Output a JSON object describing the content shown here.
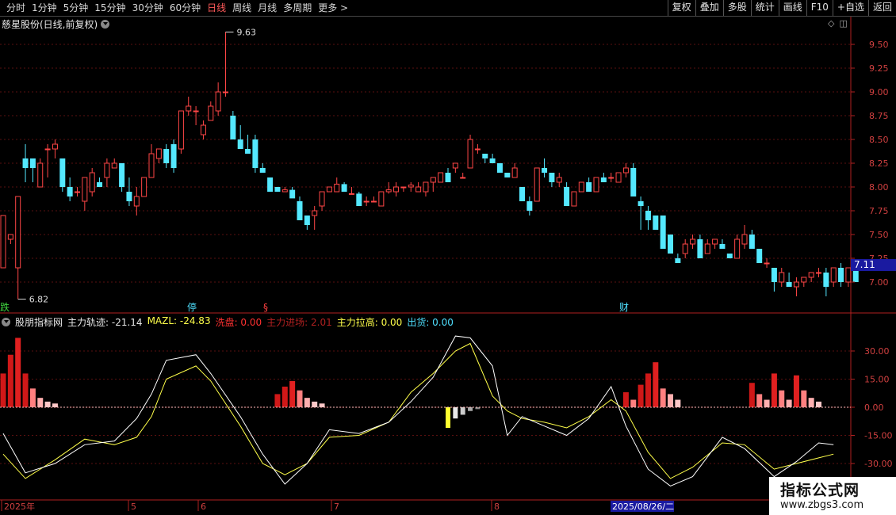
{
  "toolbar": {
    "period_tabs": [
      "分时",
      "1分钟",
      "5分钟",
      "15分钟",
      "30分钟",
      "60分钟",
      "日线",
      "周线",
      "月线",
      "多周期",
      "更多 >"
    ],
    "active_tab": "日线",
    "right_tools": [
      "复权",
      "叠加",
      "多股",
      "统计",
      "画线",
      "F10",
      "+自选",
      "返回"
    ]
  },
  "stock": {
    "title": "慈星股份(日线,前复权)"
  },
  "price_axis": {
    "ticks": [
      "9.50",
      "9.25",
      "9.00",
      "8.75",
      "8.50",
      "8.25",
      "8.00",
      "7.75",
      "7.50",
      "7.25",
      "7.00"
    ],
    "current": "7.11"
  },
  "annotations": {
    "high": "9.63",
    "low": "6.82",
    "markers": [
      {
        "text": "跌",
        "color": "#3fd43f"
      },
      {
        "text": "停",
        "color": "#4fe0ff"
      },
      {
        "text": "§",
        "color": "#ff4040"
      },
      {
        "text": "财",
        "color": "#4fe0ff"
      }
    ]
  },
  "indicator": {
    "name": "股朋指标网",
    "items": [
      {
        "label": "主力轨迹: -21.14",
        "color": "#e8e8e8"
      },
      {
        "label": "MAZL: -24.83",
        "color": "#ffff4a"
      },
      {
        "label": "洗盘: 0.00",
        "color": "#ff3030"
      },
      {
        "label": "主力进场: 2.01",
        "color": "#b02020"
      },
      {
        "label": "主力拉高: 0.00",
        "color": "#ffff4a"
      },
      {
        "label": "出货: 0.00",
        "color": "#4fe0ff"
      }
    ],
    "ticks": [
      "30.00",
      "15.00",
      "0.00",
      "-15.00",
      "-30.00"
    ]
  },
  "date_axis": {
    "labels": [
      "2025年",
      "5",
      "6",
      "7",
      "8"
    ],
    "cursor": "2025/08/26/二"
  },
  "watermark": {
    "title": "指标公式网",
    "url": "www.zbgs3.com"
  },
  "chart_data": {
    "type": "candlestick",
    "price_range": [
      6.8,
      9.7
    ],
    "candles": [
      [
        7.15,
        7.7,
        7.15,
        7.7
      ],
      [
        7.45,
        7.5,
        7.4,
        7.5
      ],
      [
        7.15,
        7.9,
        6.82,
        7.9
      ],
      [
        8.3,
        8.45,
        8.05,
        8.2
      ],
      [
        8.3,
        8.3,
        8.05,
        8.2
      ],
      [
        8.0,
        8.3,
        8.0,
        8.25
      ],
      [
        8.4,
        8.45,
        8.1,
        8.4
      ],
      [
        8.4,
        8.5,
        8.3,
        8.45
      ],
      [
        8.3,
        8.3,
        7.95,
        8.0
      ],
      [
        8.0,
        8.1,
        7.85,
        7.9
      ],
      [
        7.95,
        8.0,
        7.9,
        7.95
      ],
      [
        7.85,
        8.1,
        7.75,
        8.1
      ],
      [
        7.95,
        8.2,
        7.9,
        8.15
      ],
      [
        8.05,
        8.1,
        8.0,
        8.0
      ],
      [
        8.1,
        8.3,
        8.0,
        8.25
      ],
      [
        8.2,
        8.3,
        8.2,
        8.25
      ],
      [
        8.25,
        8.25,
        7.95,
        8.0
      ],
      [
        7.95,
        8.1,
        7.8,
        7.85
      ],
      [
        7.8,
        8.0,
        7.7,
        7.9
      ],
      [
        7.9,
        8.1,
        7.9,
        8.1
      ],
      [
        8.1,
        8.45,
        8.1,
        8.35
      ],
      [
        8.3,
        8.4,
        8.25,
        8.4
      ],
      [
        8.4,
        8.45,
        8.2,
        8.25
      ],
      [
        8.45,
        8.5,
        8.15,
        8.2
      ],
      [
        8.4,
        8.8,
        8.35,
        8.8
      ],
      [
        8.8,
        8.95,
        8.75,
        8.85
      ],
      [
        8.8,
        8.85,
        8.65,
        8.8
      ],
      [
        8.55,
        8.7,
        8.5,
        8.65
      ],
      [
        8.7,
        8.9,
        8.7,
        8.85
      ],
      [
        8.8,
        9.1,
        8.75,
        9.0
      ],
      [
        9.0,
        9.63,
        8.95,
        9.0
      ],
      [
        8.75,
        8.8,
        8.55,
        8.5
      ],
      [
        8.5,
        8.65,
        8.4,
        8.4
      ],
      [
        8.4,
        8.55,
        8.35,
        8.35
      ],
      [
        8.5,
        8.55,
        8.15,
        8.2
      ],
      [
        8.2,
        8.25,
        8.15,
        8.15
      ],
      [
        8.1,
        8.1,
        7.95,
        7.95
      ],
      [
        8.0,
        8.0,
        7.95,
        7.95
      ],
      [
        7.95,
        8.0,
        7.95,
        7.97
      ],
      [
        7.97,
        8.0,
        7.9,
        7.88
      ],
      [
        7.85,
        7.9,
        7.65,
        7.65
      ],
      [
        7.7,
        7.7,
        7.55,
        7.6
      ],
      [
        7.7,
        7.8,
        7.55,
        7.75
      ],
      [
        7.8,
        7.95,
        7.75,
        7.95
      ],
      [
        7.95,
        8.0,
        7.95,
        8.0
      ],
      [
        7.95,
        8.1,
        7.95,
        8.03
      ],
      [
        8.03,
        8.05,
        7.95,
        7.95
      ],
      [
        7.93,
        8.0,
        7.93,
        7.93
      ],
      [
        7.93,
        7.95,
        7.8,
        7.8
      ],
      [
        7.85,
        7.9,
        7.8,
        7.85
      ],
      [
        7.85,
        7.9,
        7.85,
        7.85
      ],
      [
        7.8,
        7.95,
        7.8,
        7.95
      ],
      [
        7.95,
        8.05,
        7.93,
        7.97
      ],
      [
        7.95,
        8.05,
        7.9,
        8.0
      ],
      [
        8.0,
        8.0,
        7.95,
        8.0
      ],
      [
        8.0,
        8.05,
        7.95,
        8.02
      ],
      [
        7.95,
        8.05,
        7.95,
        8.0
      ],
      [
        7.95,
        8.05,
        7.9,
        8.05
      ],
      [
        8.05,
        8.1,
        7.95,
        8.1
      ],
      [
        8.05,
        8.15,
        8.05,
        8.15
      ],
      [
        8.15,
        8.2,
        8.05,
        8.05
      ],
      [
        8.2,
        8.25,
        8.15,
        8.25
      ],
      [
        8.1,
        8.15,
        8.1,
        8.1
      ],
      [
        8.2,
        8.55,
        8.2,
        8.5
      ],
      [
        8.4,
        8.45,
        8.35,
        8.4
      ],
      [
        8.35,
        8.35,
        8.25,
        8.3
      ],
      [
        8.3,
        8.35,
        8.25,
        8.25
      ],
      [
        8.25,
        8.25,
        8.15,
        8.15
      ],
      [
        8.15,
        8.15,
        8.1,
        8.1
      ],
      [
        8.1,
        8.25,
        8.1,
        8.2
      ],
      [
        8.0,
        8.0,
        7.85,
        7.85
      ],
      [
        7.85,
        7.9,
        7.7,
        7.75
      ],
      [
        7.85,
        8.2,
        7.85,
        8.2
      ],
      [
        8.2,
        8.3,
        8.1,
        8.15
      ],
      [
        8.15,
        8.15,
        8.0,
        8.05
      ],
      [
        8.05,
        8.15,
        8.0,
        8.1
      ],
      [
        8.0,
        8.05,
        7.8,
        7.8
      ],
      [
        7.8,
        7.95,
        7.8,
        7.95
      ],
      [
        7.95,
        8.05,
        7.95,
        8.05
      ],
      [
        8.05,
        8.1,
        7.95,
        7.95
      ],
      [
        7.95,
        8.1,
        7.95,
        8.1
      ],
      [
        8.1,
        8.15,
        8.05,
        8.05
      ],
      [
        8.1,
        8.15,
        8.05,
        8.1
      ],
      [
        8.05,
        8.15,
        8.05,
        8.15
      ],
      [
        8.15,
        8.25,
        8.1,
        8.2
      ],
      [
        8.2,
        8.25,
        7.9,
        7.9
      ],
      [
        7.85,
        7.9,
        7.55,
        7.8
      ],
      [
        7.75,
        7.8,
        7.55,
        7.65
      ],
      [
        7.7,
        7.7,
        7.55,
        7.55
      ],
      [
        7.7,
        7.7,
        7.35,
        7.35
      ],
      [
        7.5,
        7.5,
        7.3,
        7.3
      ],
      [
        7.25,
        7.3,
        7.2,
        7.2
      ],
      [
        7.3,
        7.45,
        7.25,
        7.4
      ],
      [
        7.4,
        7.5,
        7.35,
        7.45
      ],
      [
        7.45,
        7.5,
        7.25,
        7.25
      ],
      [
        7.3,
        7.45,
        7.3,
        7.4
      ],
      [
        7.4,
        7.45,
        7.35,
        7.45
      ],
      [
        7.4,
        7.45,
        7.35,
        7.35
      ],
      [
        7.3,
        7.3,
        7.25,
        7.25
      ],
      [
        7.25,
        7.5,
        7.25,
        7.45
      ],
      [
        7.4,
        7.6,
        7.35,
        7.5
      ],
      [
        7.5,
        7.55,
        7.35,
        7.35
      ],
      [
        7.35,
        7.35,
        7.2,
        7.2
      ],
      [
        7.2,
        7.25,
        7.15,
        7.2
      ],
      [
        7.15,
        7.15,
        6.9,
        7.0
      ],
      [
        7.0,
        7.15,
        6.95,
        7.1
      ],
      [
        7.0,
        7.1,
        6.95,
        6.95
      ],
      [
        6.95,
        7.05,
        6.85,
        7.0
      ],
      [
        7.0,
        7.05,
        6.95,
        7.05
      ],
      [
        7.05,
        7.1,
        7.0,
        7.1
      ],
      [
        7.1,
        7.15,
        7.05,
        7.1
      ],
      [
        7.1,
        7.15,
        6.85,
        6.95
      ],
      [
        7.0,
        7.15,
        6.95,
        7.15
      ],
      [
        7.15,
        7.2,
        6.95,
        7.0
      ],
      [
        7.0,
        7.15,
        6.95,
        7.15
      ],
      [
        7.15,
        7.2,
        7.0,
        7.0
      ]
    ]
  }
}
